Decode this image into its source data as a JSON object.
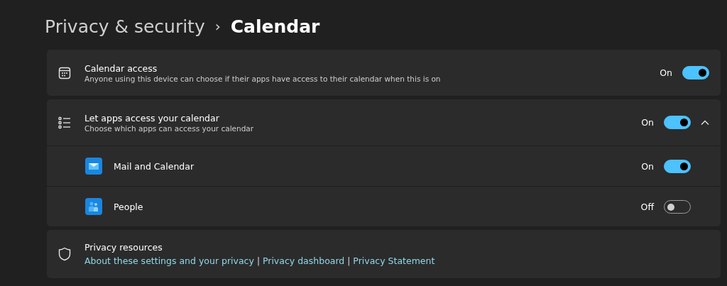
{
  "breadcrumb": {
    "parent": "Privacy & security",
    "separator": "›",
    "current": "Calendar"
  },
  "settings": [
    {
      "kind": "plain",
      "title": "Calendar access",
      "description": "Anyone using this device can choose if their apps have access to their calendar when this is on",
      "state_label": "On",
      "on": true
    },
    {
      "kind": "expander",
      "title": "Let apps access your calendar",
      "description": "Choose which apps can access your calendar",
      "state_label": "On",
      "on": true,
      "expanded": true,
      "children": [
        {
          "name": "Mail and Calendar",
          "state_label": "On",
          "on": true
        },
        {
          "name": "People",
          "state_label": "Off",
          "on": false
        }
      ]
    }
  ],
  "resources": {
    "title": "Privacy resources",
    "links": [
      {
        "kind": "link",
        "text": "About these settings and your privacy"
      },
      {
        "kind": "separator",
        "text": "|"
      },
      {
        "kind": "link",
        "text": "Privacy dashboard"
      },
      {
        "kind": "separator",
        "text": "|"
      },
      {
        "kind": "link",
        "text": "Privacy Statement"
      }
    ]
  }
}
